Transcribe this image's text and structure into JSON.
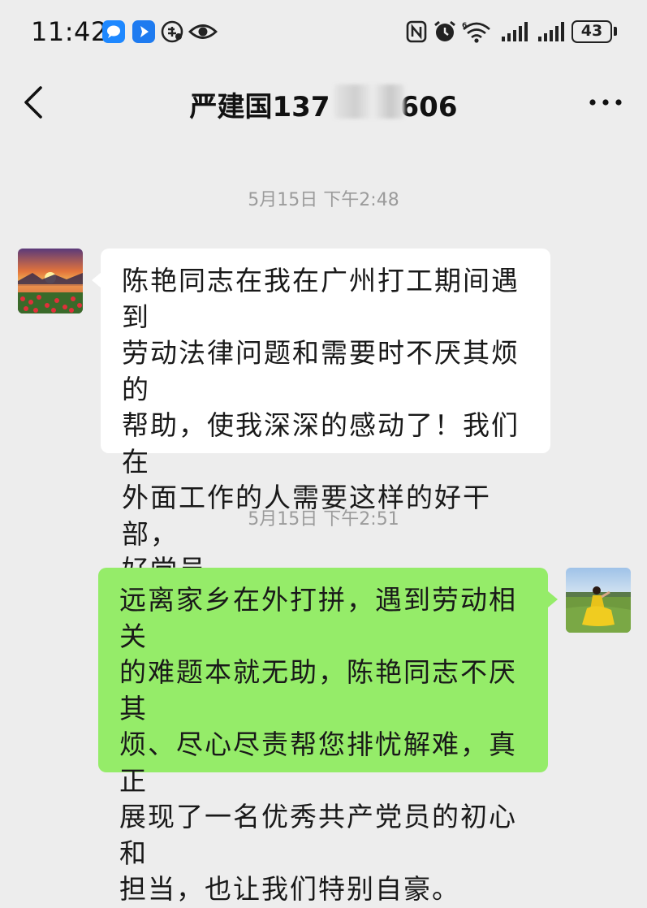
{
  "status_bar": {
    "time": "11:42",
    "battery_level": "43",
    "left_icons": [
      "messaging-app-icon",
      "navigation-app-icon",
      "sync-icon",
      "eye-icon"
    ],
    "right_icons": [
      "nfc-icon",
      "alarm-icon",
      "wifi-6-icon",
      "signal-icon",
      "signal-icon"
    ]
  },
  "nav": {
    "title": "严建国137",
    "title_suffix": "606",
    "back_icon": "chevron-left-icon",
    "more_icon": "more-dots-icon"
  },
  "messages": [
    {
      "timestamp": "5月15日 下午2:48",
      "direction": "incoming",
      "avatar": "sunset-landscape-avatar",
      "lines": [
        "陈艳同志在我在广州打工期间遇到",
        "劳动法律问题和需要时不厌其烦的",
        "帮助，使我深深的感动了！我们在",
        "外面工作的人需要这样的好干部，",
        "好党员"
      ]
    },
    {
      "timestamp": "5月15日 下午2:51",
      "direction": "outgoing",
      "avatar": "person-on-grass-avatar",
      "lines": [
        "远离家乡在外打拼，遇到劳动相关",
        "的难题本就无助，陈艳同志不厌其",
        "烦、尽心尽责帮您排忧解难，真正",
        "展现了一名优秀共产党员的初心和",
        "担当，也让我们特别自豪。"
      ]
    }
  ],
  "colors": {
    "background": "#ededed",
    "incoming_bubble": "#ffffff",
    "outgoing_bubble": "#95ec69",
    "timestamp_text": "#9b9b9b"
  }
}
